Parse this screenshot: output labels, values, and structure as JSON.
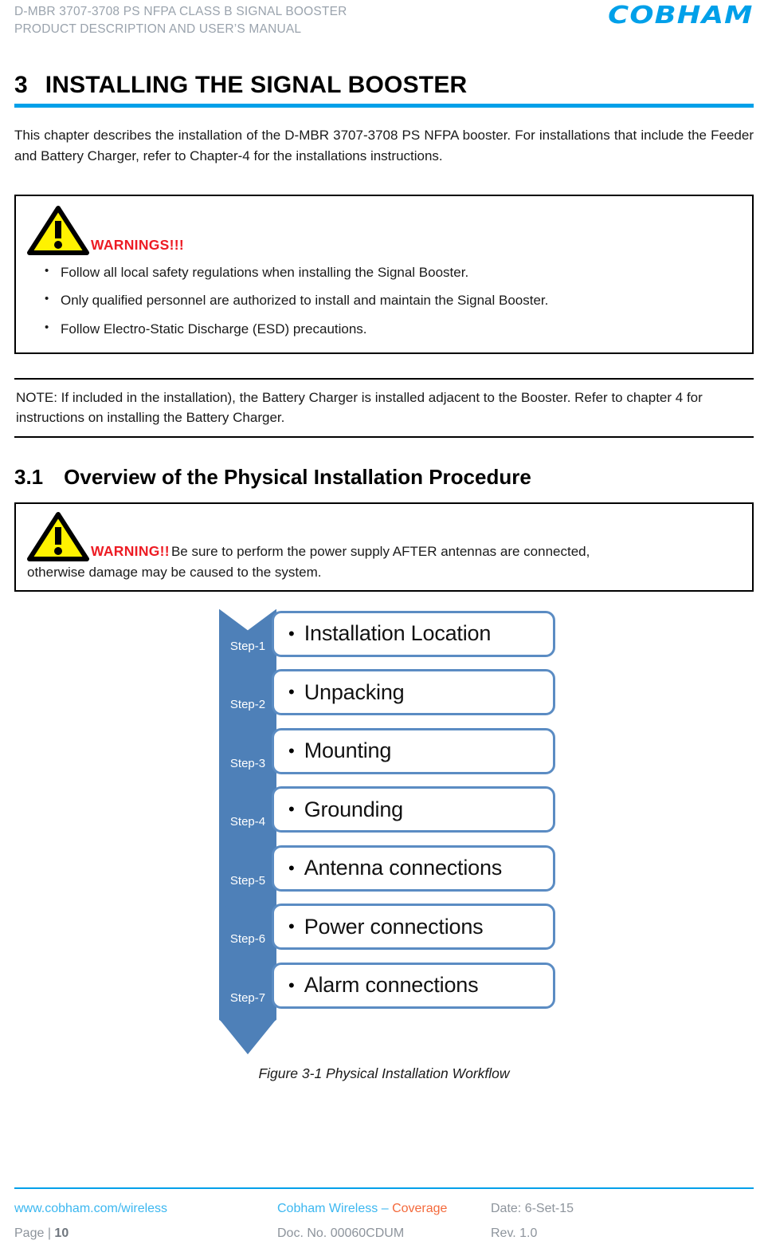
{
  "header": {
    "line1": "D-MBR 3707-3708 PS NFPA CLASS B SIGNAL BOOSTER",
    "line2": "PRODUCT DESCRIPTION AND USER’S MANUAL",
    "logo": "COBHAM",
    "accent_color": "#00A0E9"
  },
  "chapter": {
    "number": "3",
    "title": "INSTALLING THE SIGNAL BOOSTER",
    "intro": "This chapter describes the installation of the D-MBR 3707-3708 PS NFPA booster. For installations that include the Feeder and Battery Charger, refer to Chapter-4 for the installations instructions."
  },
  "warning_box": {
    "label": "WARNINGS!!!",
    "label_color": "#ED1C24",
    "icon": "warning-triangle-icon",
    "items": [
      "Follow all local safety regulations when installing the Signal Booster.",
      "Only qualified personnel are authorized to install and maintain the Signal Booster.",
      "Follow Electro-Static Discharge (ESD) precautions."
    ],
    "bullet": "•"
  },
  "note_box": {
    "text": "NOTE: If included in the installation), the Battery Charger is installed adjacent to the Booster. Refer to chapter 4 for instructions on installing the Battery Charger."
  },
  "section": {
    "number": "3.1",
    "title": "Overview of the Physical Installation Procedure"
  },
  "warning_box_2": {
    "label": "WARNING!!",
    "label_color": "#ED1C24",
    "icon": "warning-triangle-icon",
    "text_line1": "Be sure to perform the power supply AFTER antennas are connected,",
    "text_line2": "otherwise damage may be caused to the system."
  },
  "workflow": {
    "chevron_color": "#4E80B8",
    "card_border_color": "#5B8CC3",
    "bullet": "•",
    "steps": [
      {
        "step": "Step-1",
        "label": "Installation Location"
      },
      {
        "step": "Step-2",
        "label": "Unpacking"
      },
      {
        "step": "Step-3",
        "label": "Mounting"
      },
      {
        "step": "Step-4",
        "label": "Grounding"
      },
      {
        "step": "Step-5",
        "label": "Antenna connections"
      },
      {
        "step": "Step-6",
        "label": "Power connections"
      },
      {
        "step": "Step-7",
        "label": "Alarm connections"
      }
    ]
  },
  "figure": {
    "caption": "Figure 3-1  Physical Installation Workflow"
  },
  "footer": {
    "website": "www.cobham.com/wireless",
    "page_label": "Page |",
    "page_number": "10",
    "company": "Cobham Wireless",
    "company_sep": "–",
    "company_suffix": "Coverage",
    "doc_no": "Doc. No. 00060CDUM",
    "date": "Date: 6-Set-15",
    "revision": "Rev. 1.0",
    "accent_color": "#00A0E9",
    "blue": "#3BB7F0",
    "orange": "#F4693B"
  }
}
